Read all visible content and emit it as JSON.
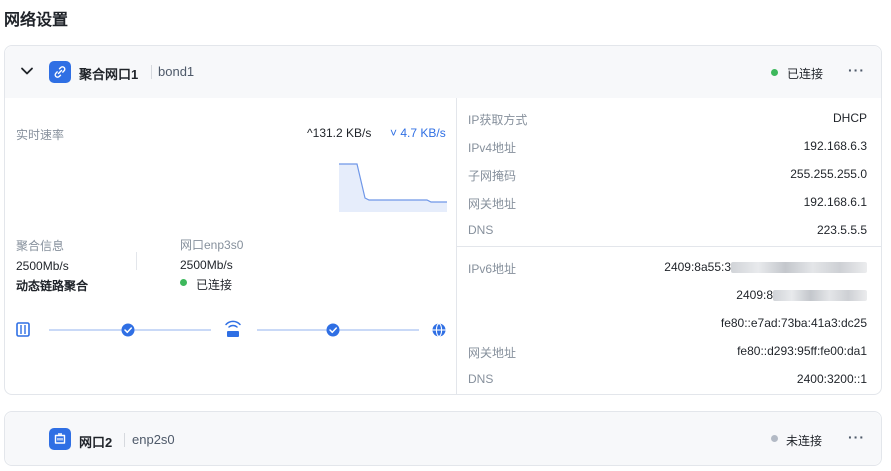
{
  "page": {
    "title": "网络设置"
  },
  "card1": {
    "name": "聚合网口1",
    "device": "bond1",
    "status": "已连接",
    "more": "···",
    "speed": {
      "label": "实时速率",
      "up": "131.2 KB/s",
      "down": "4.7 KB/s"
    },
    "aggregate": {
      "label": "聚合信息",
      "speed": "2500Mb/s",
      "mode": "动态链路聚合"
    },
    "port": {
      "label": "网口enp3s0",
      "speed": "2500Mb/s",
      "status": "已连接"
    },
    "ipv4": [
      {
        "label": "IP获取方式",
        "value": "DHCP"
      },
      {
        "label": "IPv4地址",
        "value": "192.168.6.3"
      },
      {
        "label": "子网掩码",
        "value": "255.255.255.0"
      },
      {
        "label": "网关地址",
        "value": "192.168.6.1"
      },
      {
        "label": "DNS",
        "value": "223.5.5.5"
      }
    ],
    "ipv6": {
      "label": "IPv6地址",
      "addr1_prefix": "2409:8a55:3",
      "addr2_prefix": "2409:8",
      "addr3": "fe80::e7ad:73ba:41a3:dc25",
      "gateway_label": "网关地址",
      "gateway": "fe80::d293:95ff:fe00:da1",
      "dns_label": "DNS",
      "dns": "2400:3200::1"
    },
    "colors": {
      "accent": "#2f6fe4",
      "connected": "#3db85c"
    }
  },
  "card2": {
    "name": "网口2",
    "device": "enp2s0",
    "status": "未连接",
    "more": "···",
    "colors": {
      "disconnected": "#b3bac5"
    }
  },
  "icons": {
    "collapse": "chevron-down-icon",
    "bond": "link-icon",
    "port": "ethernet-port-icon",
    "nas": "nas-device-icon",
    "router": "router-icon",
    "internet": "globe-icon",
    "check": "check-circle-icon"
  }
}
